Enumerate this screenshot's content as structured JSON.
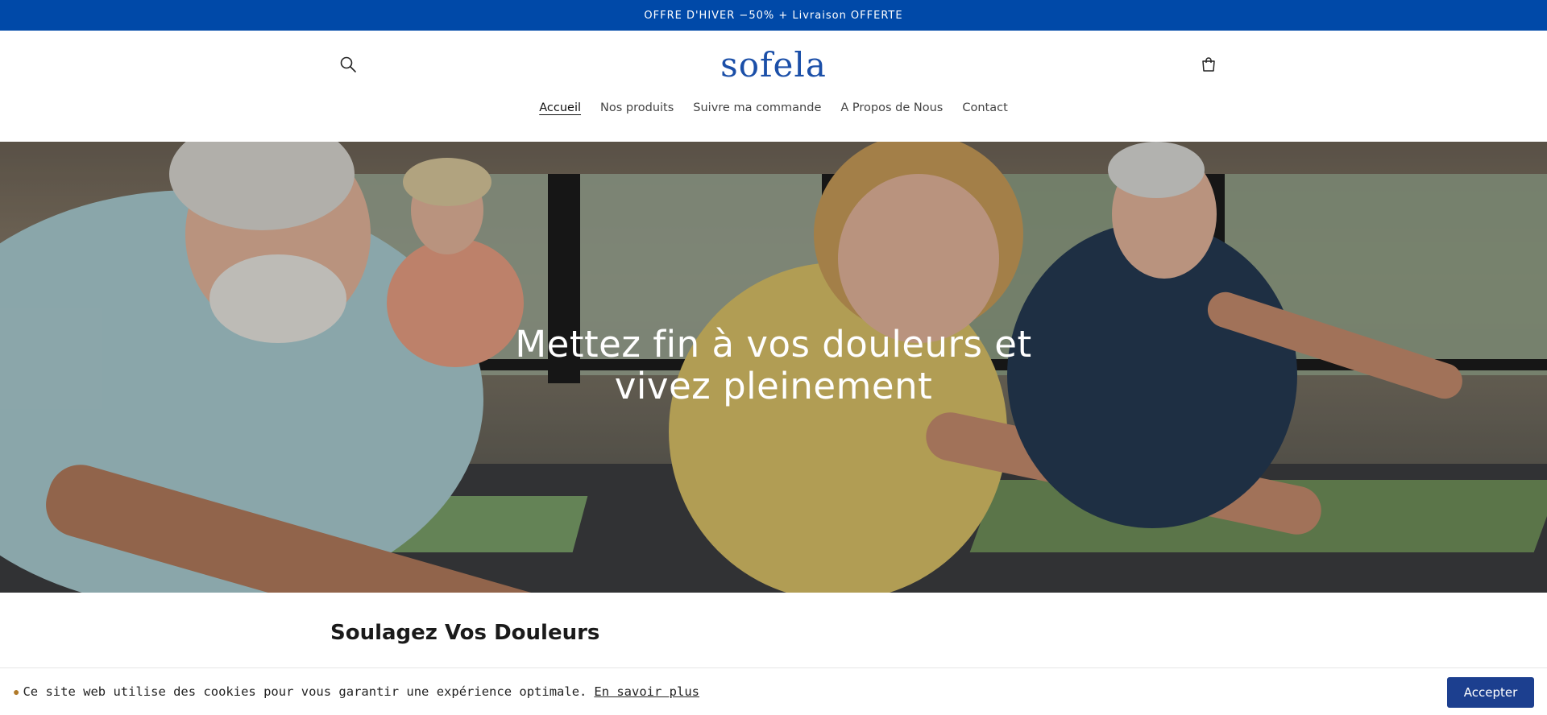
{
  "announcement": {
    "text": "OFFRE D'HIVER −50% + Livraison OFFERTE"
  },
  "header": {
    "logo": "sofela",
    "search_icon": "search-icon",
    "cart_icon": "cart-icon"
  },
  "nav": {
    "items": [
      {
        "label": "Accueil",
        "active": true
      },
      {
        "label": "Nos produits",
        "active": false
      },
      {
        "label": "Suivre ma commande",
        "active": false
      },
      {
        "label": "A Propos de Nous",
        "active": false
      },
      {
        "label": "Contact",
        "active": false
      }
    ]
  },
  "hero": {
    "title_line1": "Mettez fin à vos douleurs et",
    "title_line2": "vivez pleinement"
  },
  "section": {
    "title": "Soulagez Vos Douleurs"
  },
  "cookie": {
    "icon": "cookie-icon",
    "text": "Ce site web utilise des cookies pour vous garantir une expérience optimale.",
    "link": "En savoir plus",
    "accept": "Accepter"
  },
  "colors": {
    "announcement_bg": "#0049a8",
    "logo": "#1b4fa8",
    "accept_bg": "#1c3f8f"
  }
}
